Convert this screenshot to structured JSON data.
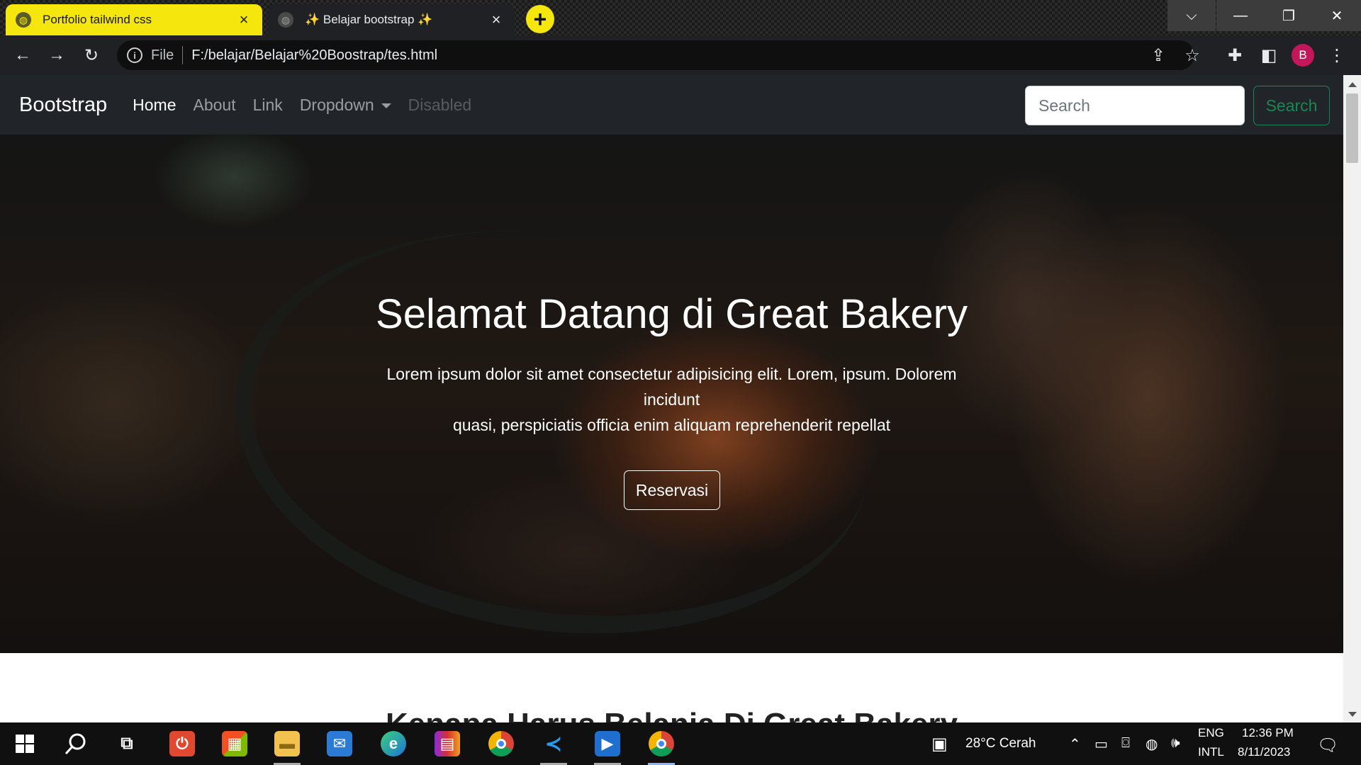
{
  "browser": {
    "tabs": [
      {
        "title": "Portfolio tailwind css",
        "active": false
      },
      {
        "title": "✨ Belajar bootstrap ✨",
        "active": true
      }
    ],
    "new_tab_label": "+",
    "address": {
      "scheme_label": "File",
      "url": "F:/belajar/Belajar%20Boostrap/tes.html"
    },
    "profile_initial": "B",
    "window_controls": {
      "tab_search": "⌵",
      "minimize": "—",
      "restore": "❐",
      "close": "✕"
    }
  },
  "page": {
    "navbar": {
      "brand": "Bootstrap",
      "links": [
        {
          "label": "Home",
          "state": "active"
        },
        {
          "label": "About",
          "state": "normal"
        },
        {
          "label": "Link",
          "state": "normal"
        },
        {
          "label": "Dropdown",
          "state": "dropdown"
        },
        {
          "label": "Disabled",
          "state": "disabled"
        }
      ],
      "search_placeholder": "Search",
      "search_button": "Search"
    },
    "hero": {
      "title": "Selamat Datang di Great Bakery",
      "text_line1": "Lorem ipsum dolor sit amet consectetur adipisicing elit. Lorem, ipsum. Dolorem incidunt",
      "text_line2": "quasi, perspiciatis officia enim aliquam reprehenderit repellat",
      "button": "Reservasi"
    },
    "next_section_title": "Kenapa Harus Belanja Di Great Bakery"
  },
  "taskbar": {
    "apps": [
      {
        "name": "start",
        "icon": "windows-logo"
      },
      {
        "name": "search",
        "icon": "search-icon"
      },
      {
        "name": "task-view",
        "icon": "task-view-icon"
      },
      {
        "name": "app-red",
        "icon": "power-app-icon"
      },
      {
        "name": "store",
        "icon": "store-icon"
      },
      {
        "name": "file-explorer",
        "icon": "folder-icon"
      },
      {
        "name": "mail",
        "icon": "mail-icon"
      },
      {
        "name": "edge",
        "icon": "edge-icon"
      },
      {
        "name": "winrar",
        "icon": "winrar-icon"
      },
      {
        "name": "chrome",
        "icon": "chrome-icon"
      },
      {
        "name": "vscode",
        "icon": "vscode-icon"
      },
      {
        "name": "media-player",
        "icon": "media-player-icon"
      },
      {
        "name": "chrome-profile",
        "icon": "chrome-profile-icon"
      }
    ],
    "weather": "28°C  Cerah",
    "lang_top": "ENG",
    "lang_bottom": "INTL",
    "time": "12:36 PM",
    "date": "8/11/2023"
  },
  "colors": {
    "tab_active_bg": "#f5e60e",
    "navbar_bg": "#212529",
    "success_green": "#198754",
    "profile_pink": "#c2185b"
  }
}
